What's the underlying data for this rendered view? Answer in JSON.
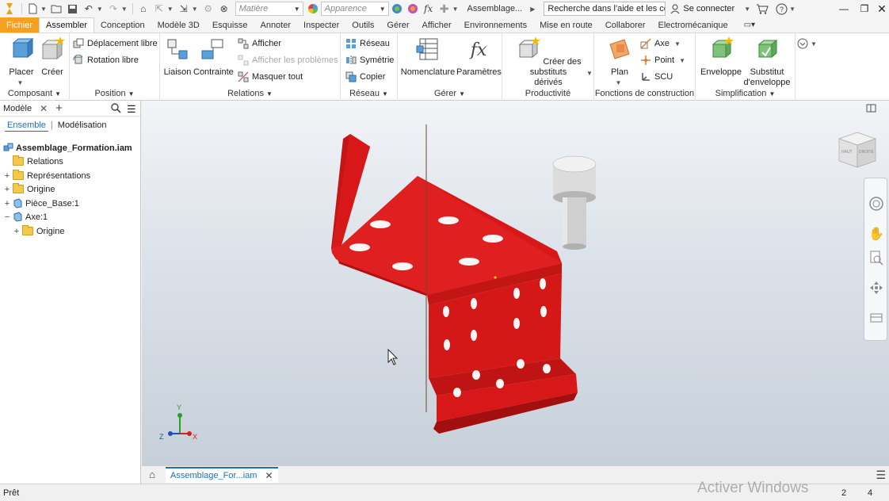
{
  "quick_access": {
    "material_placeholder": "Matière",
    "appearance_placeholder": "Apparence",
    "document_title": "Assemblage...",
    "help_search_placeholder": "Recherche dans l'aide et les com",
    "sign_in": "Se connecter"
  },
  "ribbon_tabs": [
    {
      "label": "Fichier"
    },
    {
      "label": "Assembler"
    },
    {
      "label": "Conception"
    },
    {
      "label": "Modèle 3D"
    },
    {
      "label": "Esquisse"
    },
    {
      "label": "Annoter"
    },
    {
      "label": "Inspecter"
    },
    {
      "label": "Outils"
    },
    {
      "label": "Gérer"
    },
    {
      "label": "Afficher"
    },
    {
      "label": "Environnements"
    },
    {
      "label": "Mise en route"
    },
    {
      "label": "Collaborer"
    },
    {
      "label": "Electromécanique"
    }
  ],
  "ribbon": {
    "composant": {
      "title": "Composant",
      "placer": "Placer",
      "creer": "Créer"
    },
    "position": {
      "title": "Position",
      "deplacement": "Déplacement libre",
      "rotation": "Rotation libre"
    },
    "relations": {
      "title": "Relations",
      "liaison": "Liaison",
      "contrainte": "Contrainte",
      "afficher": "Afficher",
      "afficher_problemes": "Afficher les problèmes",
      "masquer_tout": "Masquer tout"
    },
    "reseau": {
      "title": "Réseau",
      "reseau": "Réseau",
      "symetrie": "Symétrie",
      "copier": "Copier"
    },
    "gerer": {
      "title": "Gérer",
      "nomenclature": "Nomenclature",
      "parametres": "Paramètres"
    },
    "productivite": {
      "title": "Productivité",
      "substituts_1": "Créer des substituts",
      "substituts_2": "dérivés"
    },
    "construction": {
      "title": "Fonctions de construction",
      "plan": "Plan",
      "axe": "Axe",
      "point": "Point",
      "scu": "SCU"
    },
    "simplification": {
      "title": "Simplification",
      "enveloppe": "Enveloppe",
      "substitut_1": "Substitut",
      "substitut_2": "d'enveloppe"
    }
  },
  "browser": {
    "title": "Modèle",
    "tabs": {
      "ensemble": "Ensemble",
      "modelisation": "Modélisation"
    },
    "tree": {
      "root": "Assemblage_Formation.iam",
      "relations": "Relations",
      "representations": "Représentations",
      "origine": "Origine",
      "piece_base": "Pièce_Base:1",
      "axe": "Axe:1",
      "axe_origine": "Origine"
    }
  },
  "viewcube": {
    "face1": "HAUT",
    "face2": "DROITE"
  },
  "triad": {
    "x": "X",
    "y": "Y",
    "z": "Z"
  },
  "doc_tab": {
    "label": "Assemblage_For...iam"
  },
  "status": {
    "ready": "Prêt",
    "watermark": "Activer Windows",
    "count1": "2",
    "count2": "4"
  },
  "colors": {
    "part_red": "#d81818",
    "file_tab": "#f5a11e",
    "accent_blue": "#1a6fc4"
  }
}
